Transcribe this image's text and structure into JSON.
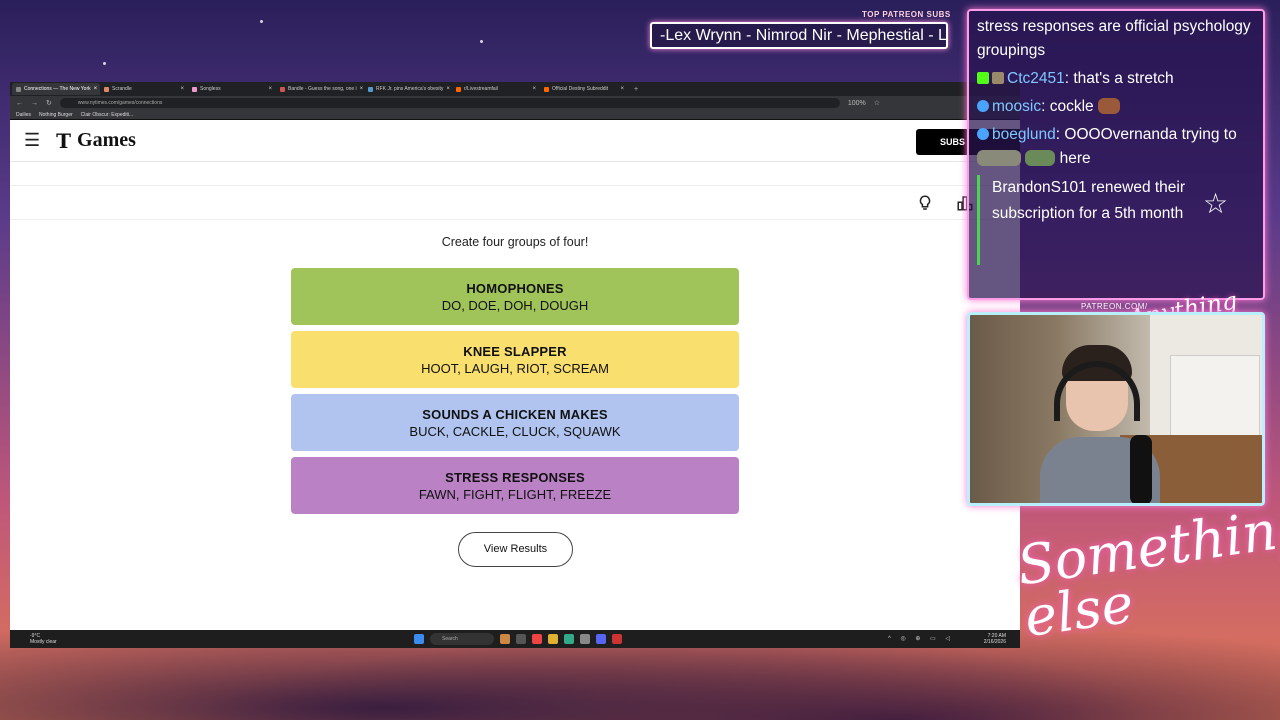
{
  "overlay": {
    "top_patreon_label": "TOP PATREON SUBS",
    "patreon_ticker": "-Lex Wrynn - Nimrod Nir - Mephestial - La",
    "patreon_label": "PATREON.COM/",
    "patreon_script": "Anything else",
    "signature": "Something else"
  },
  "browser": {
    "tabs": [
      {
        "label": "Connections — The New York",
        "active": true
      },
      {
        "label": "Scrandle",
        "active": false
      },
      {
        "label": "Songless",
        "active": false
      },
      {
        "label": "Bandle - Guess the song, one i",
        "active": false
      },
      {
        "label": "RFK Jr. pins America's obesity",
        "active": false
      },
      {
        "label": "r/Livestreamfail",
        "active": false
      },
      {
        "label": "Official Destiny Subreddit",
        "active": false
      }
    ],
    "url": "www.nytimes.com/games/connections",
    "zoom": "100%",
    "bookmarks": [
      "Dailies",
      "Nothing Burger",
      "Clair Obscur: Expediti..."
    ]
  },
  "nyt": {
    "logo_t": "T",
    "logo_games": "Games",
    "subscribe": "SUBS",
    "instruction": "Create four groups of four!",
    "groups": [
      {
        "title": "HOMOPHONES",
        "words": "DO, DOE, DOH, DOUGH",
        "color": "#a0c35a"
      },
      {
        "title": "KNEE SLAPPER",
        "words": "HOOT, LAUGH, RIOT, SCREAM",
        "color": "#f9df6d"
      },
      {
        "title": "SOUNDS A CHICKEN MAKES",
        "words": "BUCK, CACKLE, CLUCK, SQUAWK",
        "color": "#b0c4ef"
      },
      {
        "title": "STRESS RESPONSES",
        "words": "FAWN, FIGHT, FLIGHT, FREEZE",
        "color": "#ba81c5"
      }
    ],
    "view_results": "View Results"
  },
  "taskbar": {
    "temp": "-9°C",
    "weather": "Mostly clear",
    "search": "Search",
    "time": "7:20 AM",
    "date": "2/16/2026"
  },
  "chat": {
    "line0": "stress responses are official psychology groupings",
    "messages": [
      {
        "user": "Ctc2451",
        "text": ": that's a stretch"
      },
      {
        "user": "moosic",
        "text": ": cockle"
      },
      {
        "user": "boeglund",
        "text": ": OOOOvernanda trying to",
        "text2": "here"
      }
    ],
    "sub_notice": "BrandonS101 renewed their subscription for a 5th month"
  }
}
